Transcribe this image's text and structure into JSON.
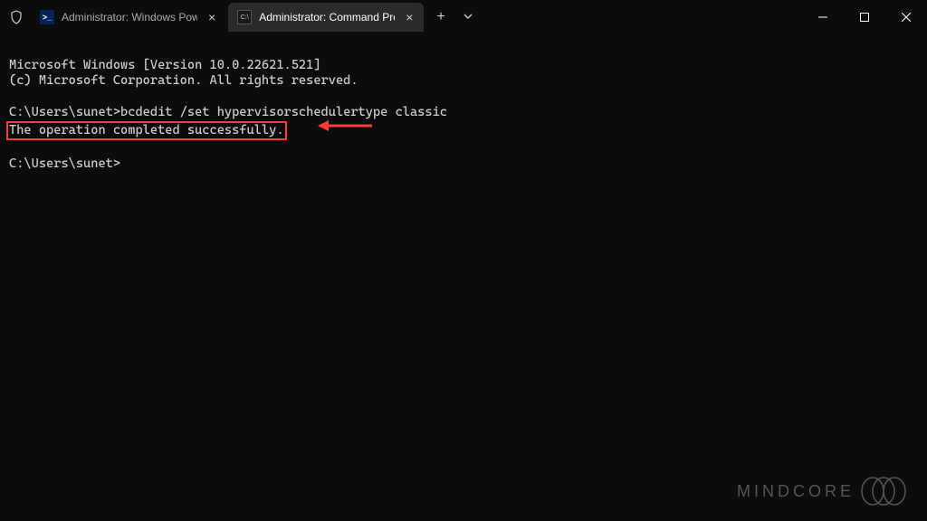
{
  "tabs": [
    {
      "title": "Administrator: Windows Powe",
      "icon": "powershell"
    },
    {
      "title": "Administrator: Command Pro",
      "icon": "cmd"
    }
  ],
  "terminal": {
    "banner_line1": "Microsoft Windows [Version 10.0.22621.521]",
    "banner_line2": "(c) Microsoft Corporation. All rights reserved.",
    "prompt1": "C:\\Users\\sunet>",
    "command1": "bcdedit /set hypervisorschedulertype classic",
    "result": "The operation completed successfully.",
    "prompt2": "C:\\Users\\sunet>"
  },
  "watermark": "MINDCORE"
}
